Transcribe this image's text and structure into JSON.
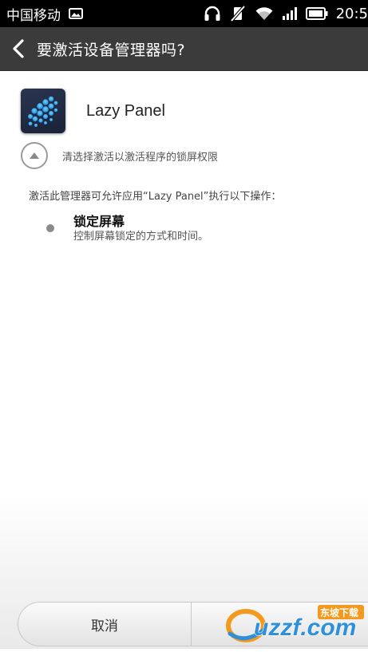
{
  "status_bar": {
    "carrier": "中国移动",
    "time": "20:5"
  },
  "title_bar": {
    "title": "要激活设备管理器吗?"
  },
  "app": {
    "name": "Lazy Panel"
  },
  "expand": {
    "label": "清选择激活以激活程序的锁屏权限"
  },
  "description": "激活此管理器可允许应用“Lazy Panel”执行以下操作：",
  "policies": [
    {
      "title": "锁定屏幕",
      "description": "控制屏幕锁定的方式和时间。"
    }
  ],
  "buttons": {
    "cancel": "取消"
  },
  "watermark": {
    "brand": "uzzf.com",
    "tagline": "东坡下载"
  },
  "colors": {
    "title_bar": "#3b3b3b",
    "status_bar": "#000000",
    "watermark_orange": "#f39a1e",
    "watermark_blue": "#2f8fd8"
  },
  "icons": {
    "status": [
      "image-icon",
      "headphones-icon",
      "vibrate-off-icon",
      "wifi-icon",
      "signal-icon",
      "battery-icon"
    ],
    "back": "chevron-left-icon",
    "expand": "triangle-up-icon",
    "app": "lazy-panel-app-icon"
  }
}
